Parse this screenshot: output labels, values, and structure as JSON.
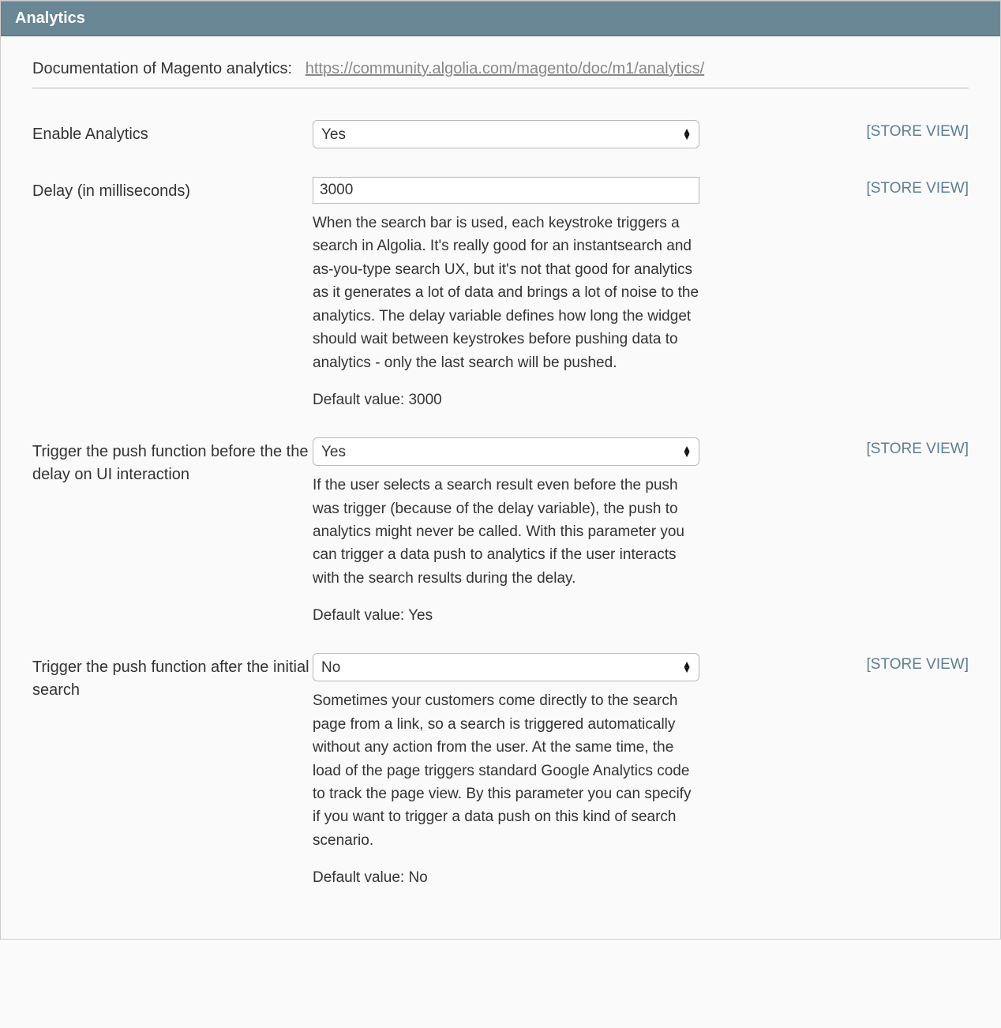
{
  "panel": {
    "title": "Analytics"
  },
  "documentation": {
    "label": "Documentation of Magento analytics:",
    "link_text": "https://community.algolia.com/magento/doc/m1/analytics/"
  },
  "scope_label": "[STORE VIEW]",
  "fields": {
    "enable_analytics": {
      "label": "Enable Analytics",
      "value": "Yes"
    },
    "delay": {
      "label": "Delay (in milliseconds)",
      "value": "3000",
      "help": "When the search bar is used, each keystroke triggers a search in Algolia. It's really good for an instantsearch and as-you-type search UX, but it's not that good for analytics as it generates a lot of data and brings a lot of noise to the analytics. The delay variable defines how long the widget should wait between keystrokes before pushing data to analytics - only the last search will be pushed.",
      "default": "Default value: 3000"
    },
    "trigger_before": {
      "label": "Trigger the push function before the the delay on UI interaction",
      "value": "Yes",
      "help": "If the user selects a search result even before the push was trigger (because of the delay variable), the push to analytics might never be called. With this parameter you can trigger a data push to analytics if the user interacts with the search results during the delay.",
      "default": "Default value: Yes"
    },
    "trigger_after": {
      "label": "Trigger the push function after the initial search",
      "value": "No",
      "help": "Sometimes your customers come directly to the search page from a link, so a search is triggered automatically without any action from the user. At the same time, the load of the page triggers standard Google Analytics code to track the page view. By this parameter you can specify if you want to trigger a data push on this kind of search scenario.",
      "default": "Default value: No"
    }
  }
}
